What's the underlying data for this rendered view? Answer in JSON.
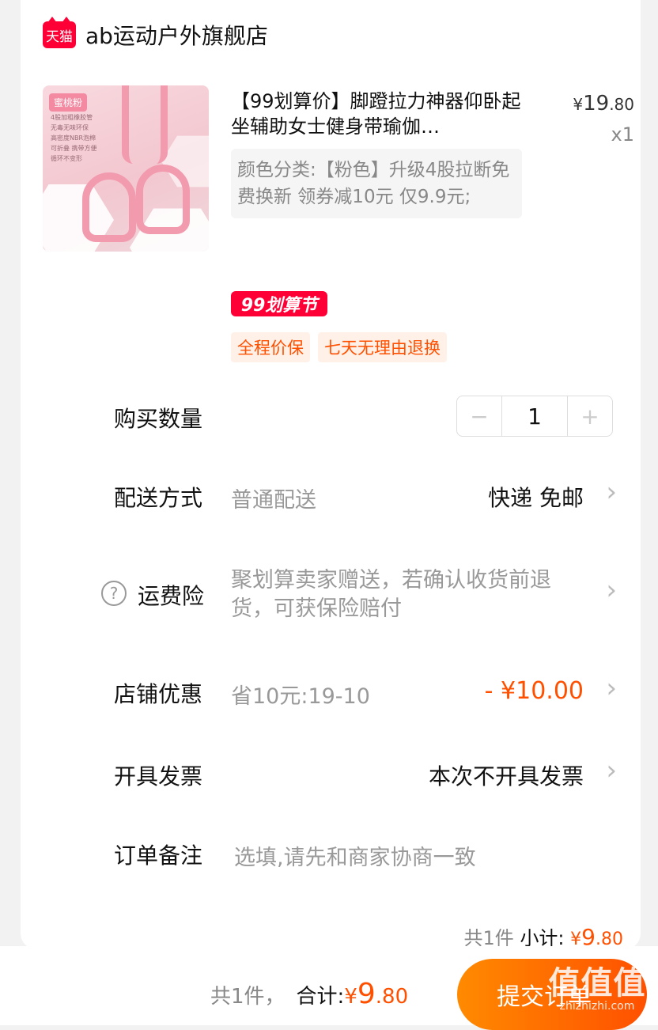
{
  "store": {
    "badge": "天猫",
    "name": "ab运动户外旗舰店"
  },
  "product": {
    "image_tag": "蜜桃粉",
    "image_lines": [
      "4股加粗橡胶管",
      "无毒无味环保",
      "高密度NBR泡棉",
      "可折叠 携带方便",
      "循环不变形"
    ],
    "title": "【99划算价】脚蹬拉力神器仰卧起坐辅助女士健身带瑜伽…",
    "price": {
      "yen": "¥",
      "int": "19",
      "dec": ".80"
    },
    "quantity": "x1",
    "sku": "颜色分类:【粉色】升级4股拉断免费换新 领券减10元 仅9.9元;",
    "promo_logo": "99划算节",
    "tags": [
      "全程价保",
      "七天无理由退换"
    ]
  },
  "rows": {
    "quantity_label": "购买数量",
    "quantity_value": "1",
    "minus": "−",
    "plus": "+",
    "delivery_label": "配送方式",
    "delivery_value": "普通配送",
    "delivery_right": "快递 免邮",
    "insurance_label": "运费险",
    "insurance_text": "聚划算卖家赠送，若确认收货前退货，可获保险赔付",
    "help_icon": "?",
    "coupon_label": "店铺优惠",
    "coupon_value": "省10元:19-10",
    "coupon_amount": "- ¥10.00",
    "invoice_label": "开具发票",
    "invoice_value": "本次不开具发票",
    "remark_label": "订单备注",
    "remark_placeholder": "选填,请先和商家协商一致",
    "chevron": "›"
  },
  "subtotal": {
    "count": "共1件",
    "label": "小计:",
    "yen": "¥",
    "int": "9",
    "dec": ".80"
  },
  "footer": {
    "count": "共1件，",
    "label": "合计:",
    "yen": "¥",
    "int": "9",
    "dec": ".80",
    "submit": "提交订单"
  },
  "watermark": {
    "big": "值值值",
    "small": "zhizhizhi.com"
  },
  "colors": {
    "accent": "#ff5000",
    "tmall_red": "#ff0036",
    "muted": "#999999"
  }
}
